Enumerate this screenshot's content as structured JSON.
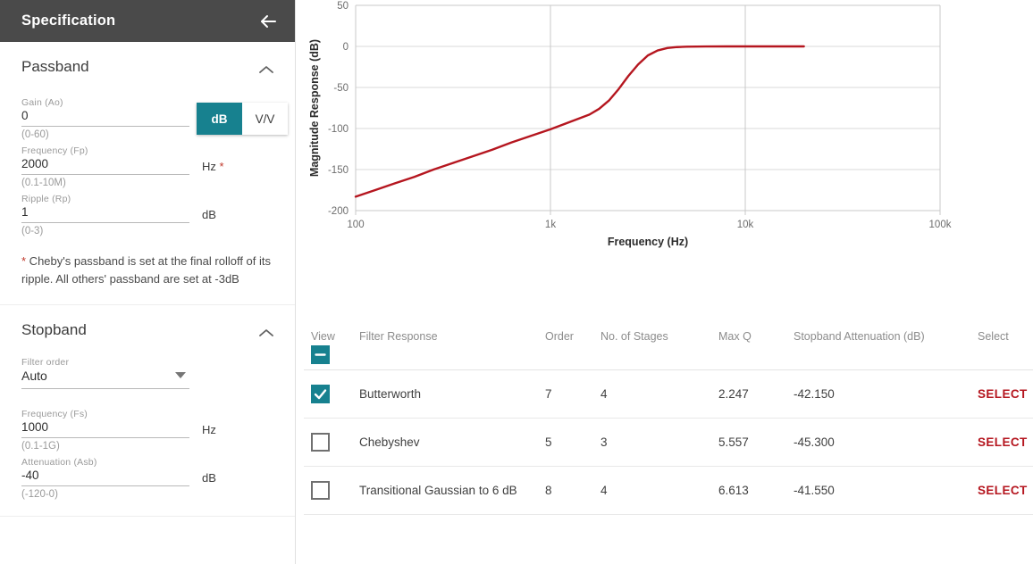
{
  "sidebar": {
    "header": {
      "title": "Specification",
      "back_icon": "arrow-left-icon"
    },
    "passband": {
      "title": "Passband",
      "collapse_icon": "chevron-up-icon",
      "gain": {
        "label": "Gain (Ao)",
        "value": "0",
        "hint": "(0-60)"
      },
      "unit_toggle": {
        "options": [
          "dB",
          "V/V"
        ],
        "selected": "dB",
        "accent": "#17818f"
      },
      "frequency": {
        "label": "Frequency (Fp)",
        "value": "2000",
        "unit": "Hz",
        "required_mark": "*",
        "hint": "(0.1-10M)"
      },
      "ripple": {
        "label": "Ripple (Rp)",
        "value": "1",
        "unit": "dB",
        "hint": "(0-3)"
      },
      "note_star": "*",
      "note": " Cheby's passband is set at the final rolloff of its ripple. All others' passband are set at -3dB"
    },
    "stopband": {
      "title": "Stopband",
      "collapse_icon": "chevron-up-icon",
      "filter_order": {
        "label": "Filter order",
        "value": "Auto",
        "caret_icon": "caret-down-icon"
      },
      "frequency": {
        "label": "Frequency (Fs)",
        "value": "1000",
        "unit": "Hz",
        "hint": "(0.1-1G)"
      },
      "attenuation": {
        "label": "Attenuation (Asb)",
        "value": "-40",
        "unit": "dB",
        "hint": "(-120-0)"
      }
    }
  },
  "chart_data": {
    "type": "line",
    "title": "",
    "xlabel": "Frequency (Hz)",
    "ylabel": "Magnitude Response (dB)",
    "xscale": "log",
    "xlim": [
      100,
      100000
    ],
    "ylim": [
      -200,
      50
    ],
    "xticks": [
      100,
      1000,
      10000,
      100000
    ],
    "xtick_labels": [
      "100",
      "1k",
      "10k",
      "100k"
    ],
    "yticks": [
      -200,
      -150,
      -100,
      -50,
      0,
      50
    ],
    "ytick_labels": [
      "-200",
      "-150",
      "-100",
      "-50",
      "0",
      "50"
    ],
    "grid": true,
    "legend": "none",
    "series": [
      {
        "name": "Butterworth",
        "color": "#b5161f",
        "points": [
          [
            100,
            -183
          ],
          [
            126,
            -175
          ],
          [
            158,
            -167
          ],
          [
            200,
            -159
          ],
          [
            251,
            -150
          ],
          [
            316,
            -142
          ],
          [
            398,
            -134
          ],
          [
            501,
            -126
          ],
          [
            631,
            -117
          ],
          [
            794,
            -109
          ],
          [
            1000,
            -101
          ],
          [
            1259,
            -92
          ],
          [
            1585,
            -83
          ],
          [
            1778,
            -76
          ],
          [
            1995,
            -66
          ],
          [
            2239,
            -52
          ],
          [
            2512,
            -36
          ],
          [
            2818,
            -22
          ],
          [
            3162,
            -11
          ],
          [
            3548,
            -5
          ],
          [
            3981,
            -2
          ],
          [
            4467,
            -0.8
          ],
          [
            5012,
            -0.3
          ],
          [
            6310,
            -0.1
          ],
          [
            7943,
            0
          ],
          [
            10000,
            0
          ],
          [
            12589,
            0
          ],
          [
            15849,
            0
          ],
          [
            20000,
            0
          ]
        ]
      }
    ]
  },
  "table": {
    "view_header_label": "View",
    "header_checkbox_state": "indeterminate",
    "columns": [
      "Filter Response",
      "Order",
      "No. of Stages",
      "Max Q",
      "Stopband Attenuation (dB)",
      "Select"
    ],
    "select_label": "SELECT",
    "select_icon": "chevron-right-icon",
    "accent_select": "#b5161f",
    "rows": [
      {
        "checked": true,
        "response": "Butterworth",
        "order": "7",
        "stages": "4",
        "max_q": "2.247",
        "attenuation": "-42.150"
      },
      {
        "checked": false,
        "response": "Chebyshev",
        "order": "5",
        "stages": "3",
        "max_q": "5.557",
        "attenuation": "-45.300"
      },
      {
        "checked": false,
        "response": "Transitional Gaussian to 6 dB",
        "order": "8",
        "stages": "4",
        "max_q": "6.613",
        "attenuation": "-41.550"
      }
    ]
  }
}
